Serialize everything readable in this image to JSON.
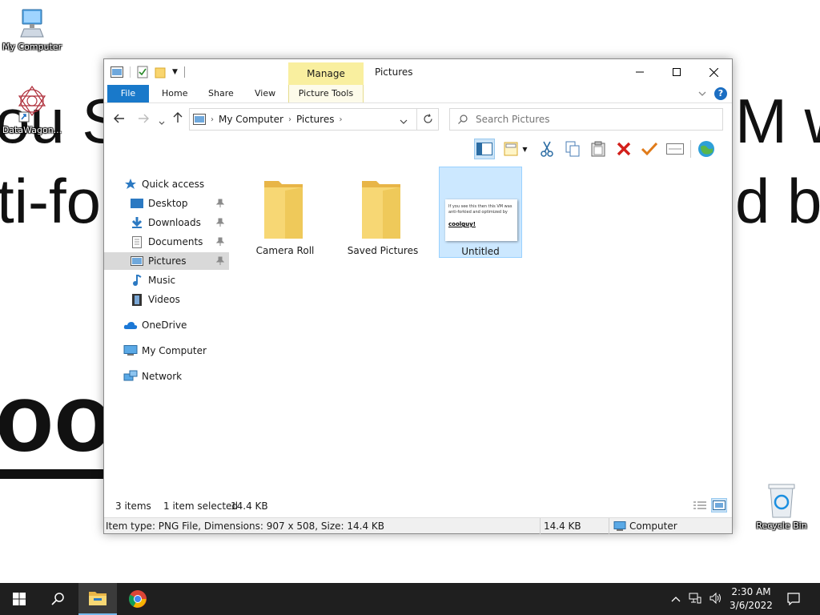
{
  "desktop": {
    "wallpaper_text": {
      "line1_left": "ou S",
      "line1_right": "M w",
      "line2_left": "ti-fo",
      "line2_right": "d by",
      "line3": "ool"
    },
    "icons": [
      {
        "label": "My Computer"
      },
      {
        "label": "DataWagon..."
      },
      {
        "label": "Recycle Bin"
      }
    ]
  },
  "window": {
    "title": "Pictures",
    "contextual_tab": "Manage",
    "ribbon_tabs": [
      "File",
      "Home",
      "Share",
      "View",
      "Picture Tools"
    ],
    "address": {
      "crumbs": [
        "My Computer",
        "Pictures"
      ]
    },
    "search": {
      "placeholder": "Search Pictures"
    },
    "nav": {
      "quick_access": "Quick access",
      "items": [
        "Desktop",
        "Downloads",
        "Documents",
        "Pictures",
        "Music",
        "Videos"
      ],
      "onedrive": "OneDrive",
      "my_computer": "My Computer",
      "network": "Network"
    },
    "files": [
      {
        "name": "Camera Roll",
        "type": "folder"
      },
      {
        "name": "Saved Pictures",
        "type": "folder"
      },
      {
        "name": "Untitled",
        "type": "image",
        "selected": true,
        "thumb_text": "If you see this then this VM was anti-forkied and optimized by",
        "thumb_bold": "coolguy!"
      }
    ],
    "status": {
      "count": "3 items",
      "selection": "1 item selected",
      "size": "14.4 KB"
    },
    "details": {
      "info": "Item type: PNG File, Dimensions: 907 x 508, Size: 14.4 KB",
      "size": "14.4 KB",
      "location": "Computer"
    }
  },
  "taskbar": {
    "time": "2:30 AM",
    "date": "3/6/2022"
  },
  "colors": {
    "accent": "#1979ca",
    "manage_tab": "#f9ef9f",
    "selection": "#cce8ff",
    "taskbar": "#1f1f1f"
  }
}
